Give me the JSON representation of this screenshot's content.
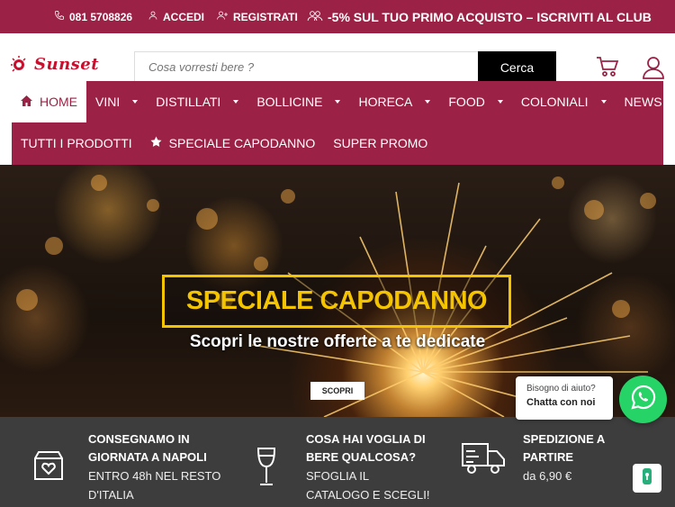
{
  "topbar": {
    "phone": "081 5708826",
    "login": "ACCEDI",
    "register": "REGISTRATI",
    "promo": "-5% SUL TUO PRIMO ACQUISTO – ISCRIVITI AL CLUB",
    "icons": [
      "phone-icon",
      "user-icon",
      "user-plus-icon",
      "users-icon"
    ]
  },
  "header": {
    "logo": "Sunset",
    "search_placeholder": "Cosa vorresti bere ?",
    "search_button": "Cerca",
    "icons": [
      "cart-icon",
      "account-icon"
    ]
  },
  "nav": {
    "row1": [
      {
        "label": "HOME",
        "active": true,
        "icon": "home-icon"
      },
      {
        "label": "VINI",
        "dropdown": true
      },
      {
        "label": "DISTILLATI",
        "dropdown": true
      },
      {
        "label": "BOLLICINE",
        "dropdown": true
      },
      {
        "label": "HORECA",
        "dropdown": true
      },
      {
        "label": "FOOD",
        "dropdown": true
      },
      {
        "label": "COLONIALI",
        "dropdown": true
      },
      {
        "label": "NEWS",
        "dropdown": false
      }
    ],
    "row2": [
      {
        "label": "TUTTI I PRODOTTI"
      },
      {
        "label": "SPECIALE CAPODANNO",
        "icon": "star-icon"
      },
      {
        "label": "SUPER PROMO"
      }
    ]
  },
  "hero": {
    "title": "SPECIALE CAPODANNO",
    "subtitle": "Scopri le nostre offerte a te dedicate",
    "button": "SCOPRI"
  },
  "features": [
    {
      "icon": "package-heart-icon",
      "title1": "CONSEGNAMO IN",
      "title2": "GIORNATA A NAPOLI",
      "text1": "ENTRO 48h NEL RESTO",
      "text2": "D'ITALIA"
    },
    {
      "icon": "wine-glass-icon",
      "title1": "COSA HAI VOGLIA DI",
      "title2": "BERE QUALCOSA?",
      "text1": "SFOGLIA IL",
      "text2": "CATALOGO E SCEGLI!"
    },
    {
      "icon": "truck-icon",
      "title1": "SPEDIZIONE A",
      "title2": "PARTIRE",
      "text1": "da 6,90 €",
      "text2": ""
    }
  ],
  "chat": {
    "question": "Bisogno di aiuto?",
    "action": "Chatta con noi",
    "icon": "whatsapp-icon"
  },
  "colors": {
    "brand": "#9b2246",
    "hero_accent": "#f5c400",
    "whatsapp": "#25d366",
    "footer_bar": "#3d3d3d"
  }
}
